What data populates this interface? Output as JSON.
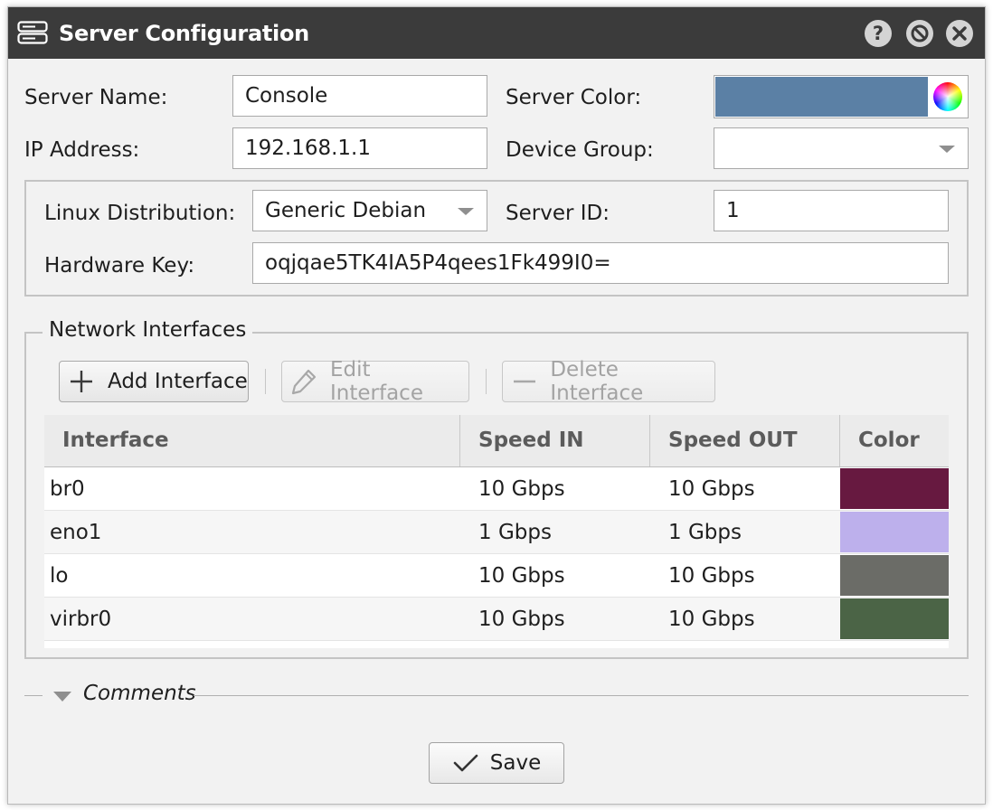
{
  "window": {
    "title": "Server Configuration",
    "icons": {
      "app": "server-icon",
      "help": "help-icon",
      "minimize": "block-icon",
      "close": "close-icon"
    }
  },
  "form": {
    "server_name": {
      "label": "Server Name:",
      "value": "Console"
    },
    "ip_address": {
      "label": "IP Address:",
      "value": "192.168.1.1"
    },
    "server_color": {
      "label": "Server Color:",
      "value": "#5b80a5"
    },
    "device_group": {
      "label": "Device Group:",
      "value": ""
    },
    "linux_distribution": {
      "label": "Linux Distribution:",
      "value": "Generic Debian"
    },
    "server_id": {
      "label": "Server ID:",
      "value": "1"
    },
    "hardware_key": {
      "label": "Hardware Key:",
      "value": "oqjqae5TK4IA5P4qees1Fk499I0="
    }
  },
  "network": {
    "legend": "Network Interfaces",
    "toolbar": {
      "add": "Add Interface",
      "edit": "Edit Interface",
      "delete": "Delete Interface"
    },
    "columns": [
      "Interface",
      "Speed IN",
      "Speed OUT",
      "Color"
    ],
    "rows": [
      {
        "interface": "br0",
        "speed_in": "10 Gbps",
        "speed_out": "10 Gbps",
        "color": "#671940"
      },
      {
        "interface": "eno1",
        "speed_in": "1 Gbps",
        "speed_out": "1 Gbps",
        "color": "#bdb0ec"
      },
      {
        "interface": "lo",
        "speed_in": "10 Gbps",
        "speed_out": "10 Gbps",
        "color": "#6b6c67"
      },
      {
        "interface": "virbr0",
        "speed_in": "10 Gbps",
        "speed_out": "10 Gbps",
        "color": "#4b6446"
      }
    ]
  },
  "comments": {
    "label": "Comments"
  },
  "footer": {
    "save_label": "Save"
  }
}
